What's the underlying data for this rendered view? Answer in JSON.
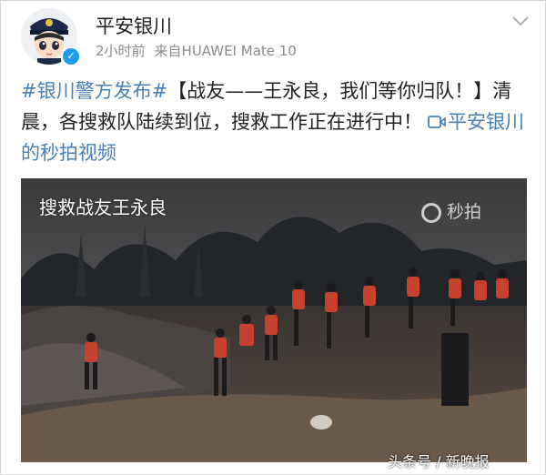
{
  "post": {
    "username": "平安银川",
    "time": "2小时前",
    "source": "来自HUAWEI Mate 10",
    "hashtag": "#银川警方发布#",
    "body": "【战友——王永良，我们等你归队！】清晨，各搜救队陆续到位，搜救工作正在进行中！",
    "video_link": "平安银川的秒拍视频"
  },
  "media": {
    "overlay_title": "搜救战友王永良",
    "watermark": "秒拍"
  },
  "source_watermark": "头条号 / 新晚报",
  "icons": {
    "avatar": "police-cartoon-avatar",
    "verified": "verified-badge-icon",
    "menu": "chevron-down-icon",
    "video": "video-camera-icon"
  },
  "colors": {
    "link": "#4a7fb4",
    "verified": "#1f9bf0"
  }
}
